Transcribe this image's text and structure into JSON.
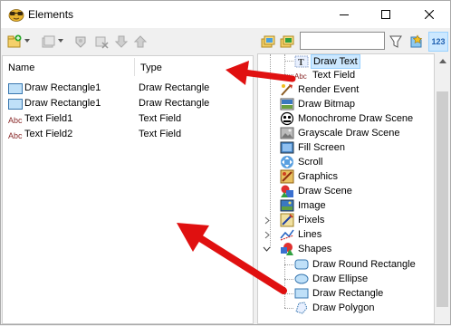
{
  "window": {
    "title": "Elements"
  },
  "colors": {
    "accent_arrow": "#e01010",
    "selection": "#cce8ff",
    "selection_border": "#99d1ff"
  },
  "toolbar": {
    "left_icons": [
      "add-element-icon",
      "add-dropdown-icon",
      "duplicate-icon",
      "delete-icon",
      "move-down-icon",
      "move-up-icon"
    ],
    "right_icons": [
      "expand-all-icon",
      "collapse-all-icon",
      "search-input",
      "filter-icon",
      "favorites-icon",
      "sort-123-icon"
    ],
    "search": {
      "value": "",
      "placeholder": ""
    },
    "sort_label": "123"
  },
  "list": {
    "columns": [
      "Name",
      "Type"
    ],
    "rows": [
      {
        "name": "Draw Rectangle1",
        "type": "Draw Rectangle",
        "icon": "rectangle-icon"
      },
      {
        "name": "Draw Rectangle1",
        "type": "Draw Rectangle",
        "icon": "rectangle-icon"
      },
      {
        "name": "Text Field1",
        "type": "Text Field",
        "icon": "text-field-icon"
      },
      {
        "name": "Text Field2",
        "type": "Text Field",
        "icon": "text-field-icon"
      }
    ]
  },
  "tree": {
    "items": [
      {
        "label": "Draw Text",
        "icon": "draw-text-icon",
        "selected": true
      },
      {
        "label": "Text Field",
        "icon": "text-field-icon"
      },
      {
        "label": "Render Event",
        "icon": "render-event-icon"
      },
      {
        "label": "Draw Bitmap",
        "icon": "draw-bitmap-icon"
      },
      {
        "label": "Monochrome Draw Scene",
        "icon": "monochrome-scene-icon"
      },
      {
        "label": "Grayscale Draw Scene",
        "icon": "grayscale-scene-icon"
      },
      {
        "label": "Fill Screen",
        "icon": "fill-screen-icon"
      },
      {
        "label": "Scroll",
        "icon": "scroll-icon"
      },
      {
        "label": "Graphics",
        "icon": "graphics-icon"
      },
      {
        "label": "Draw Scene",
        "icon": "draw-scene-icon"
      },
      {
        "label": "Image",
        "icon": "image-icon"
      },
      {
        "label": "Pixels",
        "icon": "pixels-icon",
        "collapsed": true
      },
      {
        "label": "Lines",
        "icon": "lines-icon",
        "collapsed": true
      },
      {
        "label": "Shapes",
        "icon": "shapes-icon",
        "expanded": true
      },
      {
        "label": "Draw Round Rectangle",
        "icon": "round-rectangle-icon"
      },
      {
        "label": "Draw Ellipse",
        "icon": "ellipse-icon"
      },
      {
        "label": "Draw Rectangle",
        "icon": "rectangle-icon"
      },
      {
        "label": "Draw Polygon",
        "icon": "polygon-icon"
      }
    ]
  }
}
